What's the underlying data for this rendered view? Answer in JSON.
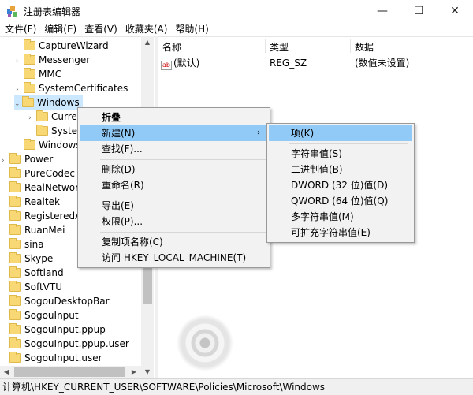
{
  "window": {
    "title": "注册表编辑器",
    "minimize": "—",
    "maximize": "☐",
    "close": "✕"
  },
  "menubar": [
    "文件(F)",
    "编辑(E)",
    "查看(V)",
    "收藏夹(A)",
    "帮助(H)"
  ],
  "tree": [
    {
      "label": "CaptureWizard",
      "arrow": ""
    },
    {
      "label": "Messenger",
      "arrow": "›"
    },
    {
      "label": "MMC",
      "arrow": ""
    },
    {
      "label": "SystemCertificates",
      "arrow": "›"
    },
    {
      "label": "Windows",
      "arrow": "⌄"
    },
    {
      "label": "Curre",
      "arrow": "›"
    },
    {
      "label": "Syster",
      "arrow": ""
    },
    {
      "label": "Windows",
      "arrow": ""
    },
    {
      "label": "Power",
      "arrow": "›"
    },
    {
      "label": "PureCodec",
      "arrow": ""
    },
    {
      "label": "RealNetworks",
      "arrow": ""
    },
    {
      "label": "Realtek",
      "arrow": ""
    },
    {
      "label": "RegisteredAppl",
      "arrow": ""
    },
    {
      "label": "RuanMei",
      "arrow": ""
    },
    {
      "label": "sina",
      "arrow": ""
    },
    {
      "label": "Skype",
      "arrow": ""
    },
    {
      "label": "Softland",
      "arrow": ""
    },
    {
      "label": "SoftVTU",
      "arrow": ""
    },
    {
      "label": "SogouDesktopBar",
      "arrow": ""
    },
    {
      "label": "SogouInput",
      "arrow": ""
    },
    {
      "label": "SogouInput.ppup",
      "arrow": ""
    },
    {
      "label": "SogouInput.ppup.user",
      "arrow": ""
    },
    {
      "label": "SogouInput.user",
      "arrow": ""
    }
  ],
  "list": {
    "headers": {
      "name": "名称",
      "type": "类型",
      "data": "数据"
    },
    "rows": [
      {
        "icon_text": "ab",
        "name": "(默认)",
        "type": "REG_SZ",
        "data": "(数值未设置)"
      }
    ]
  },
  "context_menu": [
    "折叠",
    "新建(N)",
    "查找(F)...",
    "删除(D)",
    "重命名(R)",
    "导出(E)",
    "权限(P)...",
    "复制项名称(C)",
    "访问 HKEY_LOCAL_MACHINE(T)"
  ],
  "submenu_arrow": "›",
  "submenu": [
    "项(K)",
    "字符串值(S)",
    "二进制值(B)",
    "DWORD (32 位)值(D)",
    "QWORD (64 位)值(Q)",
    "多字符串值(M)",
    "可扩充字符串值(E)"
  ],
  "statusbar": "计算机\\HKEY_CURRENT_USER\\SOFTWARE\\Policies\\Microsoft\\Windows",
  "colors": {
    "selection": "#91c9f7",
    "folder": "#f8d775",
    "menu_bg": "#f2f2f2"
  },
  "icons": {
    "app": "regedit-icon",
    "folder": "folder-icon",
    "value": "string-value-icon"
  }
}
